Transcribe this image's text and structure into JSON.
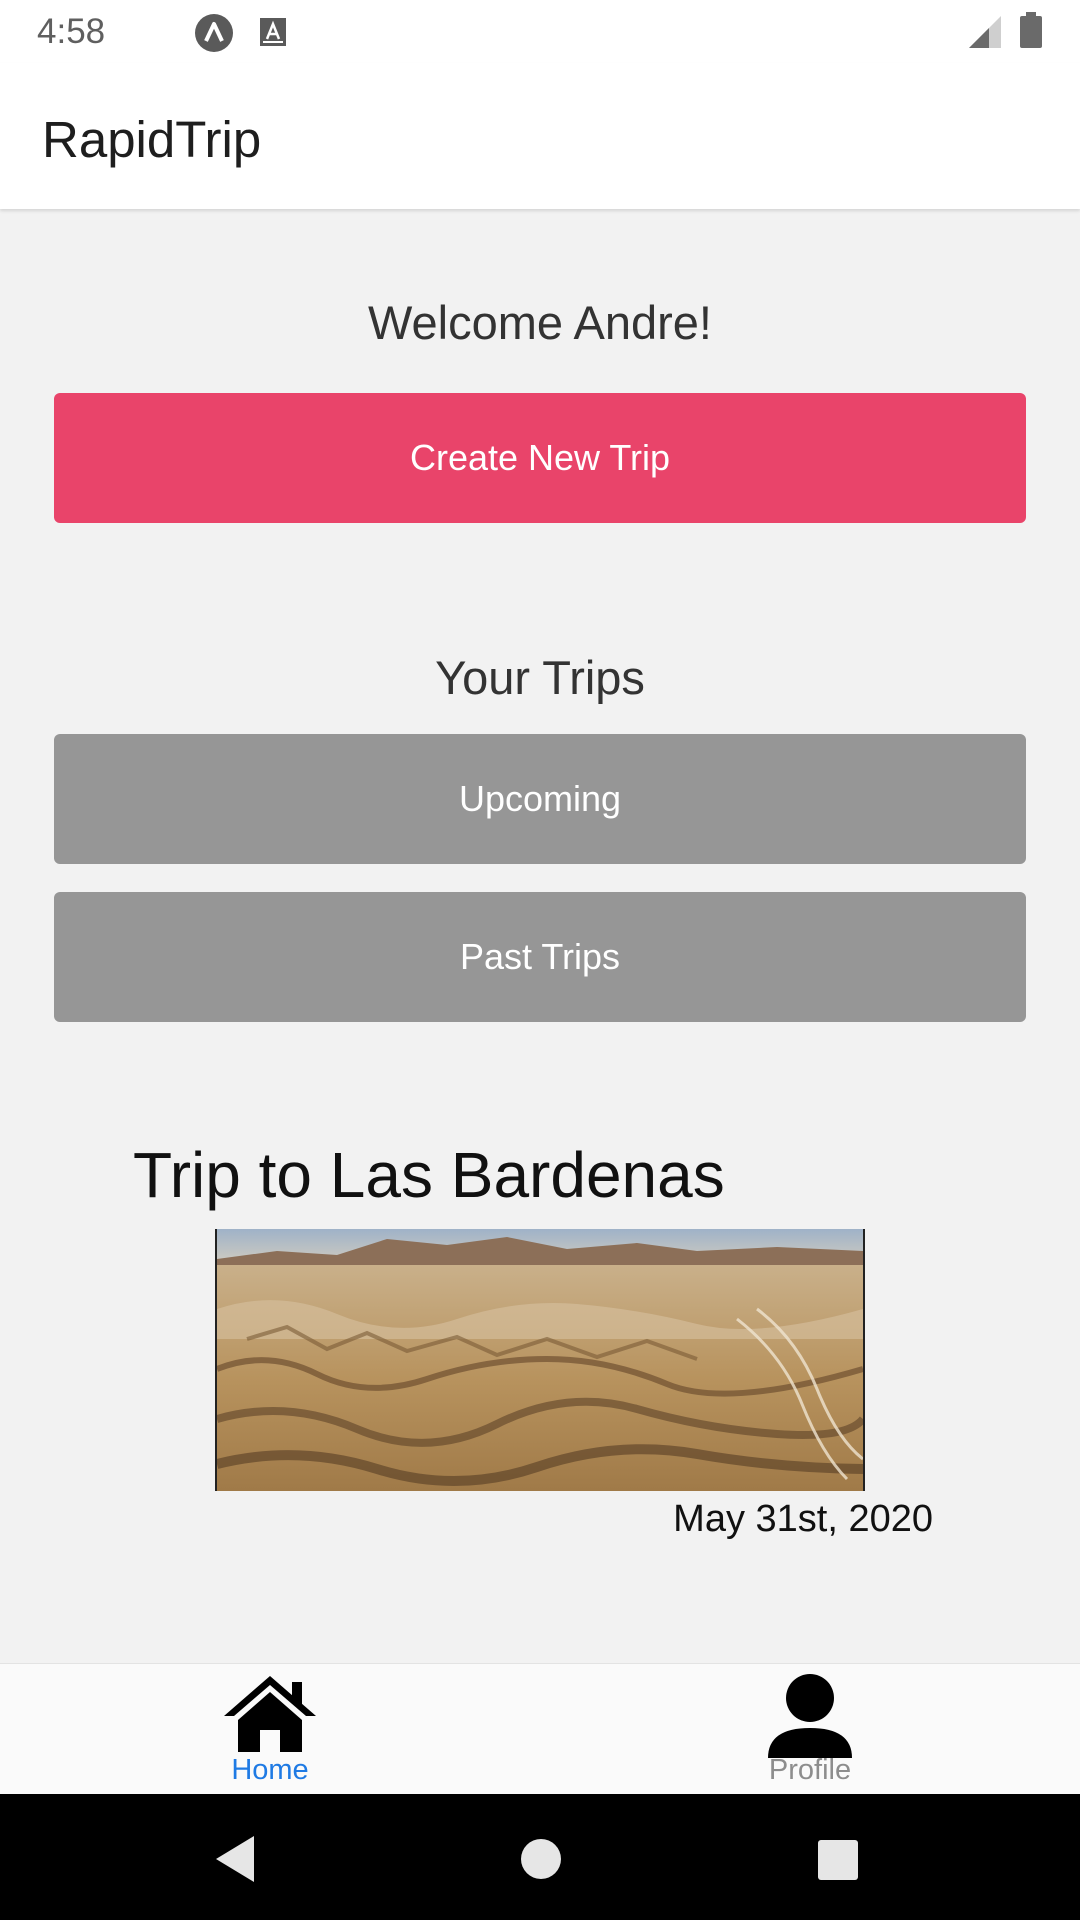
{
  "status_bar": {
    "time": "4:58",
    "icons": [
      "expo-icon",
      "text-a-icon",
      "signal-icon",
      "battery-icon"
    ]
  },
  "app_bar": {
    "title": "RapidTrip"
  },
  "home": {
    "welcome": "Welcome Andre!",
    "create_trip_label": "Create New Trip",
    "your_trips_title": "Your Trips",
    "upcoming_label": "Upcoming",
    "past_trips_label": "Past Trips"
  },
  "trip_card": {
    "title": "Trip to Las Bardenas",
    "date": "May 31st, 2020",
    "image_description_icon": "desert-landscape-image"
  },
  "bottom_nav": {
    "items": [
      {
        "label": "Home",
        "icon": "home-icon",
        "active": true
      },
      {
        "label": "Profile",
        "icon": "person-icon",
        "active": false
      }
    ]
  },
  "colors": {
    "primary_button": "#e9446a",
    "secondary_button": "#969696",
    "active_nav": "#1e7ae4",
    "inactive_nav": "#8d8d8d",
    "background": "#f2f2f2"
  }
}
